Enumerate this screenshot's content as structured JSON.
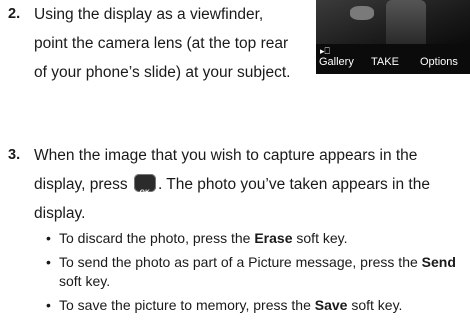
{
  "step2": {
    "number": "2.",
    "text": "Using the display as a viewfinder, point the camera lens (at the top rear of your phone’s slide) at your subject."
  },
  "phone_screen": {
    "indicator": "▸⎕",
    "softkeys": {
      "left": "Gallery",
      "center": "TAKE",
      "right": "Options"
    }
  },
  "step3": {
    "number": "3.",
    "text_before": "When the image that you wish to capture appears in the display, press",
    "ok_key_label": "OK",
    "text_after": ". The photo you’ve taken appears in the display."
  },
  "bullets": [
    {
      "before": "To discard the photo, press the ",
      "key": "Erase",
      "after": " soft key."
    },
    {
      "before": "To send the photo as part of a Picture message, press the ",
      "key": "Send",
      "after": " soft key."
    },
    {
      "before": "To save the picture to memory, press the ",
      "key": "Save",
      "after": " soft key."
    }
  ]
}
